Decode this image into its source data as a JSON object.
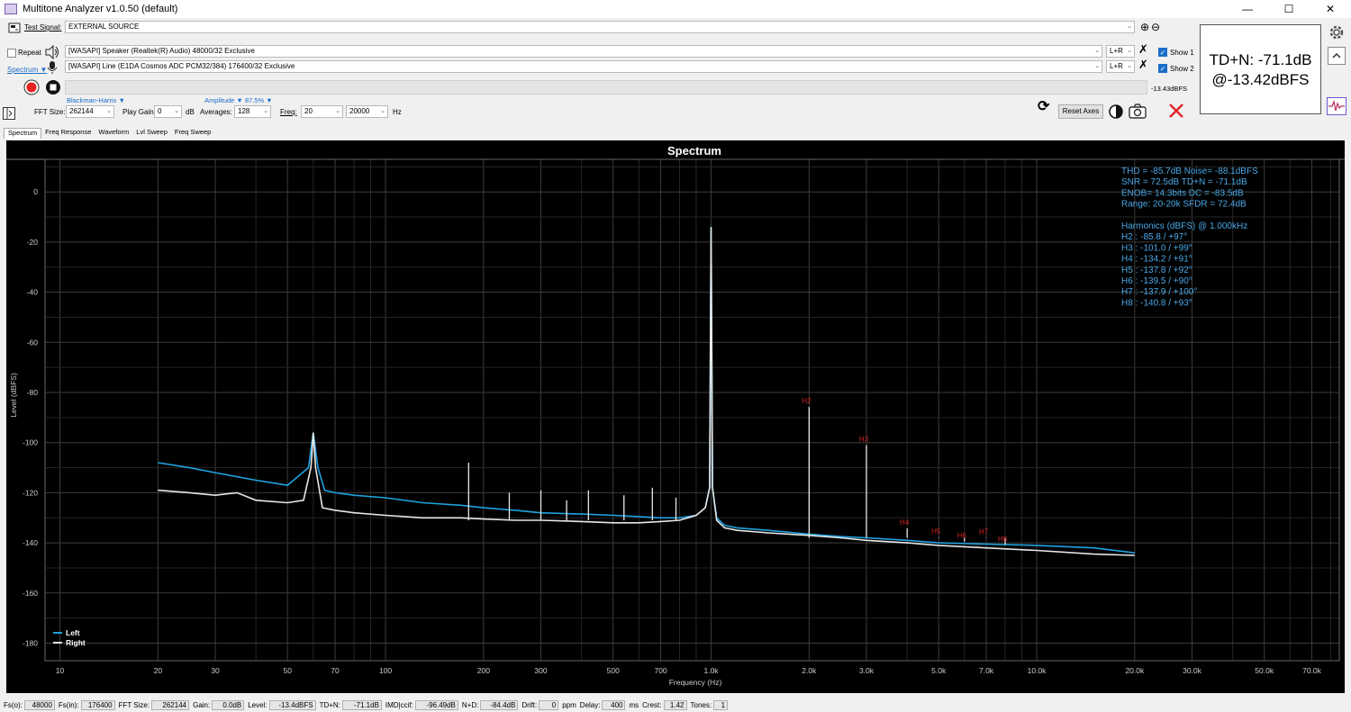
{
  "window": {
    "title": "Multitone Analyzer v1.0.50 (default)",
    "controls": [
      "—",
      "☐",
      "✕"
    ]
  },
  "signal": {
    "label": "Test Signal:",
    "value": "EXTERNAL SOURCE"
  },
  "output": {
    "repeat_label": "Repeat",
    "device": "[WASAPI] Speaker (Realtek(R) Audio) 48000/32 Exclusive",
    "channel": "L+R",
    "show_label": "Show 1"
  },
  "input": {
    "spectrum_label": "Spectrum ▼",
    "device": "[WASAPI] Line (E1DA Cosmos ADC PCM32/384) 176400/32 Exclusive",
    "channel": "L+R",
    "show_label": "Show 2"
  },
  "level_readout": "-13.43dBFS",
  "settings": {
    "window_fn": "Blackman-Harris ▼",
    "amplitude": "Amplitude ▼ 87.5% ▼",
    "fft_size_label": "FFT Size:",
    "fft_size": "262144",
    "play_gain_label": "Play Gain:",
    "play_gain": "0",
    "db_unit": "dB",
    "averages_label": "Averages:",
    "averages": "128",
    "freq_label": "Freq:",
    "freq_min": "20",
    "freq_max": "20000",
    "hz_unit": "Hz",
    "reset_axes": "Reset Axes"
  },
  "tdn_display": {
    "line1": "TD+N: -71.1dB",
    "line2": "@-13.42dBFS"
  },
  "tabs": [
    "Spectrum",
    "Freq Response",
    "Waveform",
    "Lvl Sweep",
    "Freq Sweep"
  ],
  "colors": {
    "left": "#1fa3e0",
    "right": "#e8e8e8",
    "stats": "#4aa8e8",
    "harmonic_labels": "#d02020",
    "grid": "#3c3c3c"
  },
  "stats": {
    "lines": [
      "THD = -85.7dB     Noise= -88.1dBFS",
      "SNR =  72.5dB     TD+N = -71.1dB",
      "ENOB=  14.3bits   DC   = -83.5dB",
      "Range: 20-20k     SFDR =  72.4dB",
      "",
      "Harmonics (dBFS) @ 1.000kHz",
      "H2 :   -85.8 /  +97°",
      "H3 :  -101.0 /  +99°",
      "H4 :  -134.2 /  +91°",
      "H5 :  -137.8 /  +92°",
      "H6 :  -139.5 /  +90°",
      "H7 :  -137.9 / +100°",
      "H8 :  -140.8 /  +93°"
    ]
  },
  "chart_data": {
    "type": "line",
    "title": "Spectrum",
    "xlabel": "Frequency (Hz)",
    "ylabel": "Level (dBFS)",
    "x_scale": "log",
    "xlim": [
      9,
      85000
    ],
    "ylim": [
      -187,
      13
    ],
    "x_ticks": [
      {
        "v": 10,
        "l": "10"
      },
      {
        "v": 20,
        "l": "20"
      },
      {
        "v": 30,
        "l": "30"
      },
      {
        "v": 50,
        "l": "50"
      },
      {
        "v": 70,
        "l": "70"
      },
      {
        "v": 100,
        "l": "100"
      },
      {
        "v": 200,
        "l": "200"
      },
      {
        "v": 300,
        "l": "300"
      },
      {
        "v": 500,
        "l": "500"
      },
      {
        "v": 700,
        "l": "700"
      },
      {
        "v": 1000,
        "l": "1.0k"
      },
      {
        "v": 2000,
        "l": "2.0k"
      },
      {
        "v": 3000,
        "l": "3.0k"
      },
      {
        "v": 5000,
        "l": "5.0k"
      },
      {
        "v": 7000,
        "l": "7.0k"
      },
      {
        "v": 10000,
        "l": "10.0k"
      },
      {
        "v": 20000,
        "l": "20.0k"
      },
      {
        "v": 30000,
        "l": "30.0k"
      },
      {
        "v": 50000,
        "l": "50.0k"
      },
      {
        "v": 70000,
        "l": "70.0k"
      }
    ],
    "y_ticks": [
      0,
      -20,
      -40,
      -60,
      -80,
      -100,
      -120,
      -140,
      -160,
      -180
    ],
    "grid": true,
    "legend_position": "bottom-left",
    "series": [
      {
        "name": "Left",
        "color": "#1fa3e0",
        "x": [
          20,
          25,
          30,
          40,
          50,
          58,
          60,
          62,
          65,
          70,
          80,
          100,
          130,
          170,
          200,
          250,
          300,
          400,
          500,
          600,
          700,
          800,
          900,
          960,
          990,
          1000,
          1010,
          1040,
          1100,
          1200,
          1500,
          2000,
          2500,
          3000,
          4000,
          5000,
          7000,
          10000,
          15000,
          20000
        ],
        "y": [
          -108,
          -110,
          -112,
          -115,
          -117,
          -110,
          -96,
          -110,
          -119,
          -120,
          -121,
          -122,
          -124,
          -125,
          -126,
          -127,
          -128,
          -128.5,
          -129,
          -129.5,
          -130,
          -130,
          -129,
          -126,
          -118,
          -14,
          -118,
          -130,
          -133,
          -134,
          -135,
          -136.5,
          -137.5,
          -138,
          -139,
          -140,
          -140.5,
          -141,
          -142,
          -144
        ]
      },
      {
        "name": "Right",
        "color": "#e8e8e8",
        "x": [
          20,
          25,
          30,
          35,
          40,
          50,
          56,
          59,
          60,
          61,
          64,
          70,
          80,
          100,
          130,
          170,
          200,
          250,
          300,
          400,
          500,
          600,
          700,
          800,
          900,
          960,
          990,
          1000,
          1010,
          1040,
          1100,
          1200,
          1500,
          2000,
          2500,
          3000,
          4000,
          5000,
          7000,
          10000,
          15000,
          20000
        ],
        "y": [
          -119,
          -120,
          -121,
          -120,
          -123,
          -124,
          -123,
          -110,
          -96,
          -110,
          -126,
          -127,
          -128,
          -129,
          -130,
          -130,
          -130.5,
          -131,
          -131,
          -131.5,
          -132,
          -132,
          -131.5,
          -131,
          -129,
          -126,
          -118,
          -14,
          -118,
          -131,
          -134,
          -135,
          -136,
          -137,
          -138,
          -139,
          -140,
          -141,
          -142,
          -143,
          -144.5,
          -145
        ]
      }
    ],
    "spurs": [
      {
        "f": 180,
        "db": -108
      },
      {
        "f": 240,
        "db": -120
      },
      {
        "f": 300,
        "db": -119
      },
      {
        "f": 360,
        "db": -123
      },
      {
        "f": 420,
        "db": -119
      },
      {
        "f": 540,
        "db": -121
      },
      {
        "f": 660,
        "db": -118
      },
      {
        "f": 780,
        "db": -122
      }
    ],
    "harmonics": [
      {
        "label": "H2",
        "f": 2000,
        "db": -85.8
      },
      {
        "label": "H3",
        "f": 3000,
        "db": -101.0
      },
      {
        "label": "H4",
        "f": 4000,
        "db": -134.2
      },
      {
        "label": "H5",
        "f": 5000,
        "db": -137.8
      },
      {
        "label": "H6",
        "f": 6000,
        "db": -139.5
      },
      {
        "label": "H7",
        "f": 7000,
        "db": -137.9
      },
      {
        "label": "H8",
        "f": 8000,
        "db": -140.8
      }
    ]
  },
  "status": {
    "fs_out_label": "Fs(o):",
    "fs_out": "48000",
    "fs_in_label": "Fs(in):",
    "fs_in": "176400",
    "fft_label": "FFT Size:",
    "fft": "262144",
    "gain_label": "Gain:",
    "gain": "0.0dB",
    "level_label": "Level:",
    "level": "-13.4dBFS",
    "tdn_label": "TD+N:",
    "tdn": "-71.1dB",
    "imd_label": "IMD|ccif:",
    "imd": "-96.49dB",
    "nd_label": "N+D:",
    "nd": "-84.4dB",
    "drift_label": "Drift:",
    "drift": "0",
    "ppm": "ppm",
    "delay_label": "Delay:",
    "delay": "400",
    "ms": "ms",
    "crest_label": "Crest:",
    "crest": "1.42",
    "tones_label": "Tones:",
    "tones": "1"
  }
}
